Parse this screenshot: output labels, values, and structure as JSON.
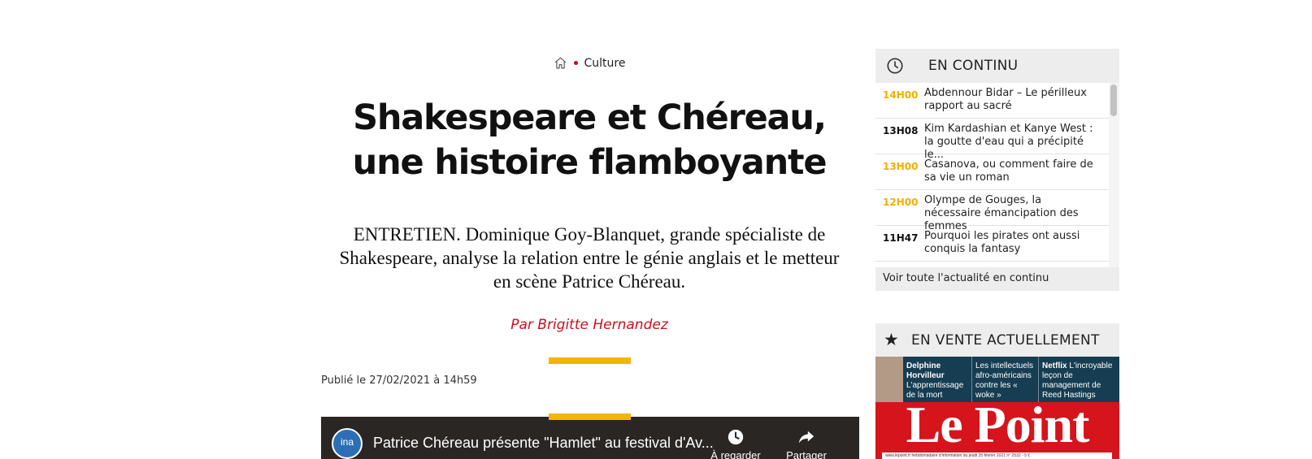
{
  "breadcrumb": {
    "section": "Culture"
  },
  "article": {
    "title": "Shakespeare et Chéreau, une histoire flamboyante",
    "standfirst": "ENTRETIEN. Dominique Goy-Blanquet, grande spécialiste de Shakespeare, analyse la relation entre le génie anglais et le metteur en scène Patrice Chéreau.",
    "author": "Par Brigitte Hernandez",
    "published": "Publié le 27/02/2021 à 14h59"
  },
  "video": {
    "channel_logo": "ina",
    "title": "Patrice Chéreau présente \"Hamlet\" au festival d'Av...",
    "watch_later": "À regarder",
    "share": "Partager"
  },
  "live": {
    "heading": "EN CONTINU",
    "items": [
      {
        "time": "14H00",
        "text": "Abdennour Bidar – Le périlleux rapport au sacré",
        "highlight": true
      },
      {
        "time": "13H08",
        "text": "Kim Kardashian et Kanye West : la goutte d'eau qui a précipité le...",
        "highlight": false
      },
      {
        "time": "13H00",
        "text": "Casanova, ou comment faire de sa vie un roman",
        "highlight": true
      },
      {
        "time": "12H00",
        "text": "Olympe de Gouges, la nécessaire émancipation des femmes",
        "highlight": true
      },
      {
        "time": "11H47",
        "text": "Pourquoi les pirates ont aussi conquis la fantasy",
        "highlight": false
      }
    ],
    "footer_link": "Voir toute l'actualité en continu"
  },
  "sale": {
    "heading": "EN VENTE ACTUELLEMENT",
    "cover": {
      "col1_name": "Delphine Horvilleur",
      "col1_text": "L'apprentissage de la mort",
      "col2_text": "Les intellectuels afro-américains contre les « woke »",
      "col3_name": "Netflix",
      "col3_text": "L'incroyable leçon de management de Reed Hastings",
      "logo": "Le Point",
      "strip": "www.lepoint.fr hebdomadaire d'information du jeudi 25 février 2021 n° 2532 - 5 €"
    }
  },
  "colors": {
    "accent": "#f5b400",
    "author": "#c9101b",
    "time_highlight": "#f0b000",
    "breadcrumb_dot": "#d0021b"
  }
}
